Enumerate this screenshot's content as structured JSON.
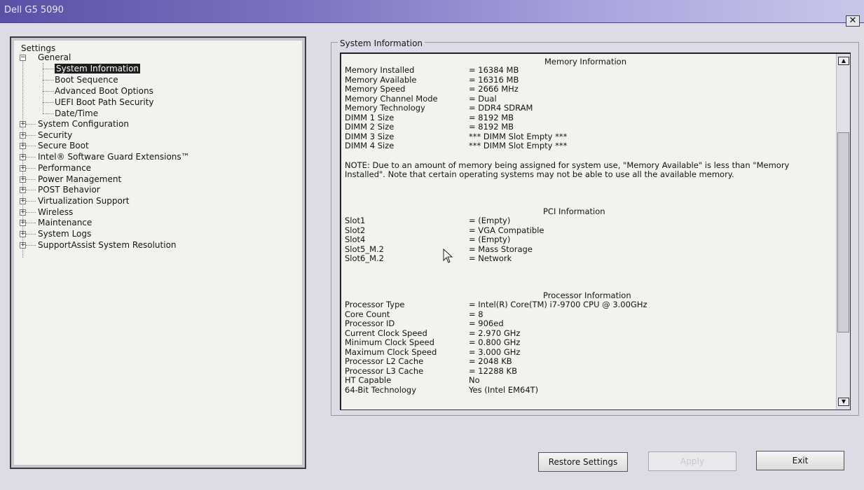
{
  "window": {
    "title": "Dell G5 5090",
    "close_symbol": "✕"
  },
  "tree": {
    "root": "Settings",
    "general": "General",
    "general_children": [
      "System Information",
      "Boot Sequence",
      "Advanced Boot Options",
      "UEFI Boot Path Security",
      "Date/Time"
    ],
    "categories": [
      "System Configuration",
      "Security",
      "Secure Boot",
      "Intel® Software Guard Extensions™",
      "Performance",
      "Power Management",
      "POST Behavior",
      "Virtualization Support",
      "Wireless",
      "Maintenance",
      "System Logs",
      "SupportAssist System Resolution"
    ],
    "selected": "System Information"
  },
  "panel": {
    "group_title": "System Information"
  },
  "memory": {
    "heading": "Memory Information",
    "rows": [
      [
        "Memory Installed",
        "= 16384 MB"
      ],
      [
        "Memory Available",
        "= 16316 MB"
      ],
      [
        "Memory Speed",
        "= 2666 MHz"
      ],
      [
        "Memory Channel Mode",
        "= Dual"
      ],
      [
        "Memory Technology",
        "= DDR4 SDRAM"
      ],
      [
        "DIMM 1 Size",
        "= 8192 MB"
      ],
      [
        "DIMM 2 Size",
        "= 8192 MB"
      ],
      [
        "DIMM 3 Size",
        "*** DIMM Slot Empty ***"
      ],
      [
        "DIMM 4 Size",
        "*** DIMM Slot Empty ***"
      ]
    ],
    "note": "NOTE: Due to an amount of memory being assigned for system use, \"Memory Available\" is less than \"Memory Installed\". Note that certain operating systems may not be able to use all the available memory."
  },
  "pci": {
    "heading": "PCI Information",
    "rows": [
      [
        "Slot1",
        "= (Empty)"
      ],
      [
        "Slot2",
        "= VGA Compatible"
      ],
      [
        "Slot4",
        "= (Empty)"
      ],
      [
        "Slot5_M.2",
        "= Mass Storage"
      ],
      [
        "Slot6_M.2",
        "= Network"
      ]
    ]
  },
  "processor": {
    "heading": "Processor Information",
    "rows": [
      [
        "Processor Type",
        "= Intel(R) Core(TM) i7-9700 CPU @ 3.00GHz"
      ],
      [
        "Core Count",
        "= 8"
      ],
      [
        "Processor ID",
        "= 906ed"
      ],
      [
        "Current Clock Speed",
        "= 2.970 GHz"
      ],
      [
        "Minimum Clock Speed",
        "= 0.800 GHz"
      ],
      [
        "Maximum Clock Speed",
        "= 3.000 GHz"
      ],
      [
        "Processor L2 Cache",
        "= 2048 KB"
      ],
      [
        "Processor L3 Cache",
        "= 12288 KB"
      ],
      [
        "HT Capable",
        "No"
      ],
      [
        "64-Bit Technology",
        "Yes (Intel EM64T)"
      ]
    ]
  },
  "buttons": {
    "restore": "Restore Settings",
    "apply": "Apply",
    "exit": "Exit"
  },
  "icons": {
    "scroll_up": "▲",
    "scroll_down": "▼",
    "expand": "+",
    "collapse": "−"
  }
}
